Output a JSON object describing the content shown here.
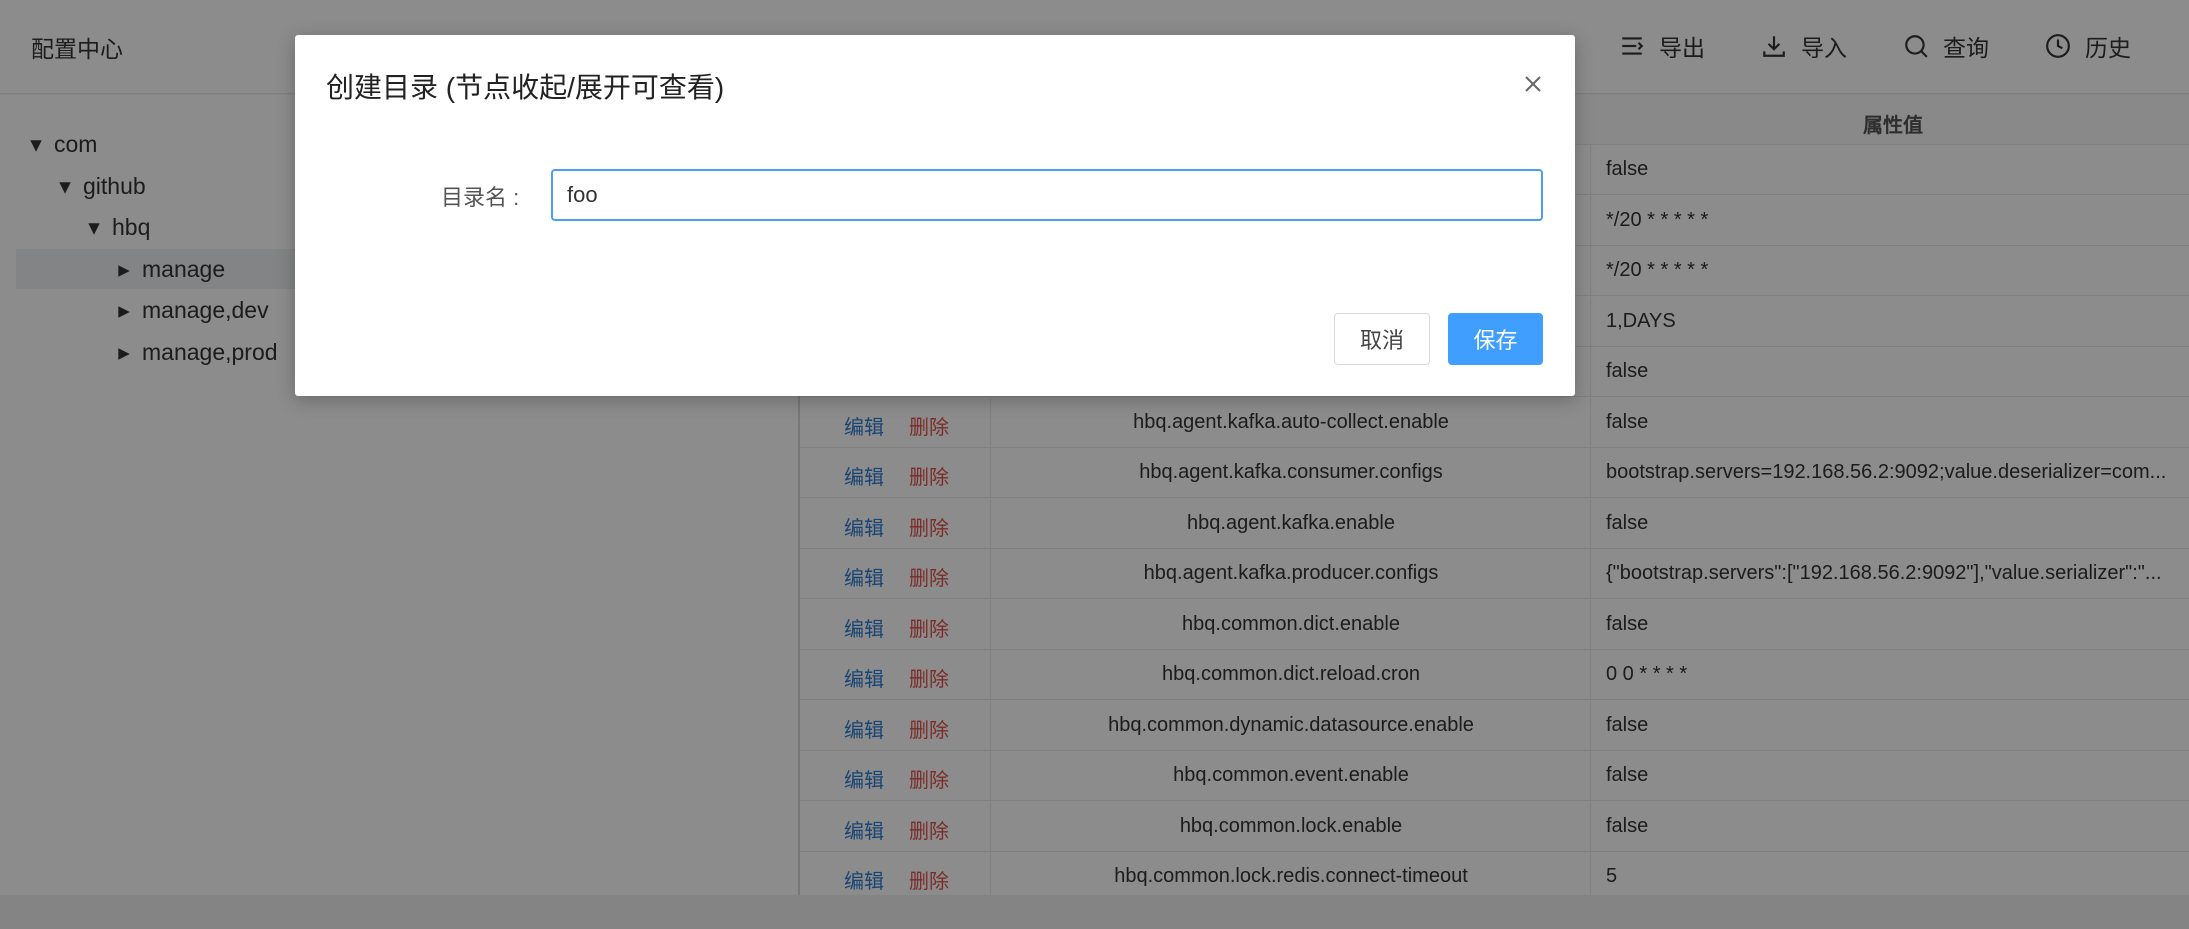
{
  "header": {
    "title": "配置中心",
    "toolbar": [
      {
        "label": "导出",
        "icon": "export-icon"
      },
      {
        "label": "导入",
        "icon": "download-icon"
      },
      {
        "label": "查询",
        "icon": "search-icon"
      },
      {
        "label": "历史",
        "icon": "clock-icon"
      }
    ]
  },
  "tree": {
    "nodes": [
      {
        "label": "com",
        "level": 0,
        "expanded": true
      },
      {
        "label": "github",
        "level": 1,
        "expanded": true
      },
      {
        "label": "hbq",
        "level": 2,
        "expanded": true
      },
      {
        "label": "manage",
        "level": 3,
        "expanded": false,
        "selected": true
      },
      {
        "label": "manage,dev",
        "level": 3,
        "expanded": false
      },
      {
        "label": "manage,prod",
        "level": 3,
        "expanded": false
      }
    ]
  },
  "table": {
    "value_header": "属性值",
    "edit_label": "编辑",
    "delete_label": "删除",
    "rows": [
      {
        "key": "",
        "value": "false"
      },
      {
        "key": "",
        "value": "*/20 * * * * *"
      },
      {
        "key": "",
        "value": "*/20 * * * * *"
      },
      {
        "key": "",
        "value": "1,DAYS"
      },
      {
        "key": "",
        "value": "false"
      },
      {
        "key": "hbq.agent.kafka.auto-collect.enable",
        "value": "false"
      },
      {
        "key": "hbq.agent.kafka.consumer.configs",
        "value": "bootstrap.servers=192.168.56.2:9092;value.deserializer=com..."
      },
      {
        "key": "hbq.agent.kafka.enable",
        "value": "false"
      },
      {
        "key": "hbq.agent.kafka.producer.configs",
        "value": "{\"bootstrap.servers\":[\"192.168.56.2:9092\"],\"value.serializer\":\"..."
      },
      {
        "key": "hbq.common.dict.enable",
        "value": "false"
      },
      {
        "key": "hbq.common.dict.reload.cron",
        "value": "0 0 * * * *"
      },
      {
        "key": "hbq.common.dynamic.datasource.enable",
        "value": "false"
      },
      {
        "key": "hbq.common.event.enable",
        "value": "false"
      },
      {
        "key": "hbq.common.lock.enable",
        "value": "false"
      },
      {
        "key": "hbq.common.lock.redis.connect-timeout",
        "value": "5"
      }
    ]
  },
  "modal": {
    "title": "创建目录 (节点收起/展开可查看)",
    "field_label": "目录名 :",
    "field_value": "foo",
    "cancel_label": "取消",
    "save_label": "保存"
  },
  "colors": {
    "primary": "#409eff",
    "link": "#2f7fd6",
    "danger": "#e0504a"
  }
}
